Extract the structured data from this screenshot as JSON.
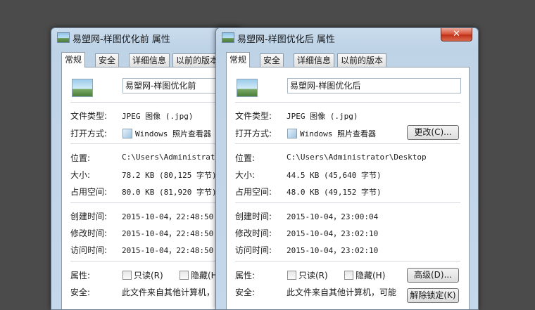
{
  "back": {
    "title": "易塑网-样图优化前 属性",
    "tabs": [
      "常规",
      "安全",
      "详细信息",
      "以前的版本"
    ],
    "filename": "易塑网-样图优化前",
    "rows": {
      "type_label": "文件类型:",
      "type_value": "JPEG 图像 (.jpg)",
      "open_label": "打开方式:",
      "open_value": "Windows 照片查看器",
      "location_label": "位置:",
      "location_value": "C:\\Users\\Administrator",
      "size_label": "大小:",
      "size_value": "78.2 KB (80,125 字节)",
      "disk_label": "占用空间:",
      "disk_value": "80.0 KB (81,920 字节)",
      "created_label": "创建时间:",
      "created_value": "2015-10-04，22:48:50",
      "modified_label": "修改时间:",
      "modified_value": "2015-10-04，22:48:50",
      "accessed_label": "访问时间:",
      "accessed_value": "2015-10-04，22:48:50",
      "attr_label": "属性:",
      "readonly_label": "只读(R)",
      "hidden_label": "隐藏(H",
      "security_label": "安全:",
      "security_value": "此文件来自其他计算机，"
    }
  },
  "front": {
    "title": "易塑网-样图优化后 属性",
    "close_glyph": "✕",
    "tabs": [
      "常规",
      "安全",
      "详细信息",
      "以前的版本"
    ],
    "filename": "易塑网-样图优化后",
    "rows": {
      "type_label": "文件类型:",
      "type_value": "JPEG 图像 (.jpg)",
      "open_label": "打开方式:",
      "open_value": "Windows 照片查看器",
      "change_button": "更改(C)...",
      "location_label": "位置:",
      "location_value": "C:\\Users\\Administrator\\Desktop",
      "size_label": "大小:",
      "size_value": "44.5 KB (45,640 字节)",
      "disk_label": "占用空间:",
      "disk_value": "48.0 KB (49,152 字节)",
      "created_label": "创建时间:",
      "created_value": "2015-10-04，23:00:04",
      "modified_label": "修改时间:",
      "modified_value": "2015-10-04，23:02:10",
      "accessed_label": "访问时间:",
      "accessed_value": "2015-10-04，23:02:10",
      "attr_label": "属性:",
      "readonly_label": "只读(R)",
      "hidden_label": "隐藏(H)",
      "advanced_button": "高级(D)...",
      "security_label": "安全:",
      "security_value": "此文件来自其他计算机，可能",
      "unblock_button": "解除锁定(K)"
    }
  }
}
